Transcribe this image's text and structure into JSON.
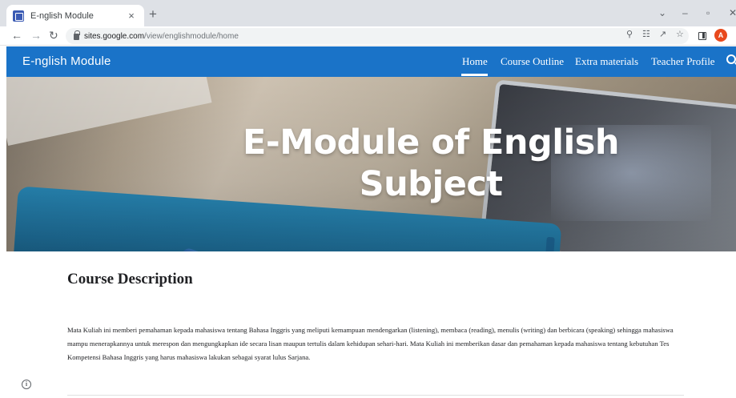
{
  "browser": {
    "tab_title": "E-nglish Module",
    "tab_close": "×",
    "new_tab": "+",
    "window_controls": {
      "chevron": "⌄",
      "minimize": "–",
      "restore": "▫",
      "close": "✕"
    },
    "url_domain": "sites.google.com",
    "url_path": "/view/englishmodule/home",
    "profile_initial": "A",
    "icons": [
      "back-icon",
      "forward-icon",
      "reload-icon",
      "lock-icon",
      "zoom-icon",
      "translate-icon",
      "share-icon",
      "star-icon",
      "side-panel-icon",
      "profile-avatar",
      "menu-icon"
    ]
  },
  "site": {
    "name": "E-nglish Module",
    "nav": [
      {
        "label": "Home",
        "active": true
      },
      {
        "label": "Course Outline"
      },
      {
        "label": "Extra materials"
      },
      {
        "label": "Teacher Profile"
      }
    ],
    "hero_title": "E-Module of English Subject",
    "section_title": "Course Description",
    "description": "Mata Kuliah ini memberi pemahaman  kepada mahasiswa tentang Bahasa Inggris yang meliputi kemampuan mendengarkan (listening), membaca (reading), menulis (writing) dan berbicara (speaking) sehingga mahasiswa mampu menerapkannya untuk merespon dan mengungkapkan ide secara lisan maupun tertulis dalam kehidupan sehari-hari. Mata Kuliah ini memberikan dasar dan pemahaman kepada mahasiswa tentang kebutuhan Tes Kompetensi Bahasa Inggris yang harus mahasiswa lakukan sebagai syarat lulus Sarjana.",
    "info_glyph": "i"
  },
  "colors": {
    "header_bg": "#1a73c8",
    "tabstrip_bg": "#dee1e6",
    "avatar_bg": "#e8491d"
  }
}
